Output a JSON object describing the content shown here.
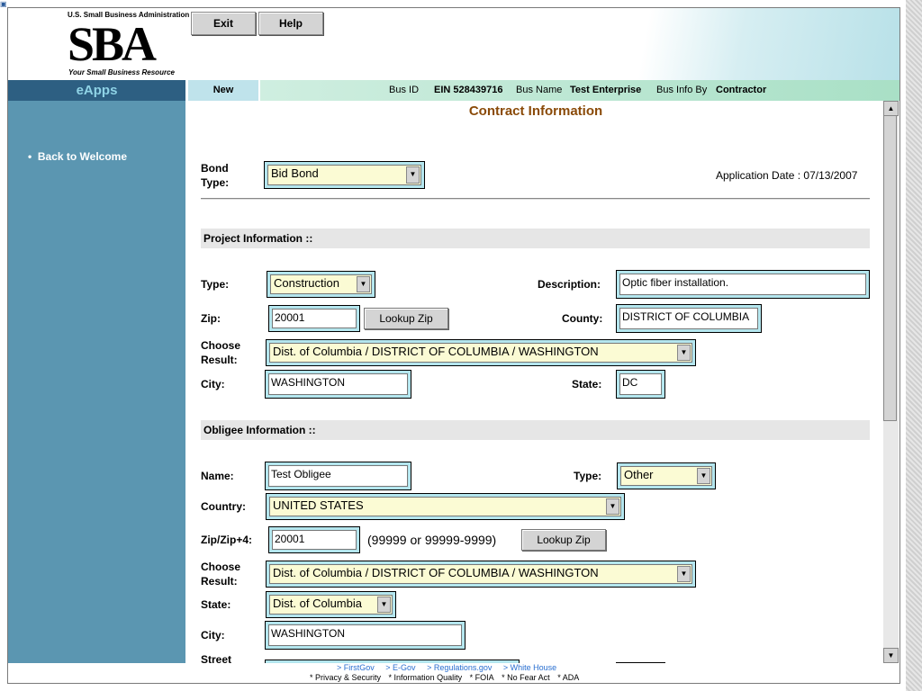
{
  "header": {
    "logo_top": "U.S. Small Business Administration",
    "logo_text": "SBA",
    "logo_tagline": "Your Small Business Resource",
    "exit_label": "Exit",
    "help_label": "Help"
  },
  "nav": {
    "eapps": "eApps",
    "new_tab": "New",
    "bus_id_label": "Bus ID",
    "ein": "EIN  528439716",
    "bus_name_label": "Bus Name",
    "bus_name": "Test Enterprise",
    "bus_info_by_label": "Bus Info By",
    "bus_info_by": "Contractor"
  },
  "sidebar": {
    "back_link": "Back to Welcome"
  },
  "page": {
    "title": "Contract Information",
    "bond_type_label": "Bond Type:",
    "bond_type_value": "Bid Bond",
    "application_date": "Application Date : 07/13/2007"
  },
  "project": {
    "section_title": "Project Information ::",
    "type_label": "Type:",
    "type_value": "Construction",
    "description_label": "Description:",
    "description_value": "Optic fiber installation.",
    "zip_label": "Zip:",
    "zip_value": "20001",
    "lookup_zip_label": "Lookup Zip",
    "county_label": "County:",
    "county_value": "DISTRICT OF COLUMBIA",
    "choose_result_label": "Choose Result:",
    "choose_result_value": "Dist. of Columbia / DISTRICT OF COLUMBIA / WASHINGTON",
    "city_label": "City:",
    "city_value": "WASHINGTON",
    "state_label": "State:",
    "state_value": "DC"
  },
  "obligee": {
    "section_title": "Obligee Information ::",
    "name_label": "Name:",
    "name_value": "Test Obligee",
    "type_label": "Type:",
    "type_value": "Other",
    "country_label": "Country:",
    "country_value": "UNITED STATES",
    "zip_label": "Zip/Zip+4:",
    "zip_value": "20001",
    "zip_hint": "(99999 or 99999-9999)",
    "lookup_zip_label": "Lookup Zip",
    "choose_result_label": "Choose Result:",
    "choose_result_value": "Dist. of Columbia / DISTRICT OF COLUMBIA / WASHINGTON",
    "state_label": "State:",
    "state_value": "Dist. of Columbia",
    "city_label": "City:",
    "city_value": "WASHINGTON",
    "street_label": "Street"
  },
  "footer": {
    "links": [
      "> FirstGov",
      "> E-Gov",
      "> Regulations.gov",
      "> White House"
    ],
    "policies": [
      "* Privacy & Security",
      "* Information Quality",
      "* FOIA",
      "* No Fear Act",
      "* ADA"
    ]
  },
  "colors": {
    "sidebar": "#5b96b1",
    "eapps_bar": "#2d5f82",
    "title": "#8a4a08",
    "field_wrap": "#b4e6ee",
    "select_bg": "#fbfbd4"
  }
}
